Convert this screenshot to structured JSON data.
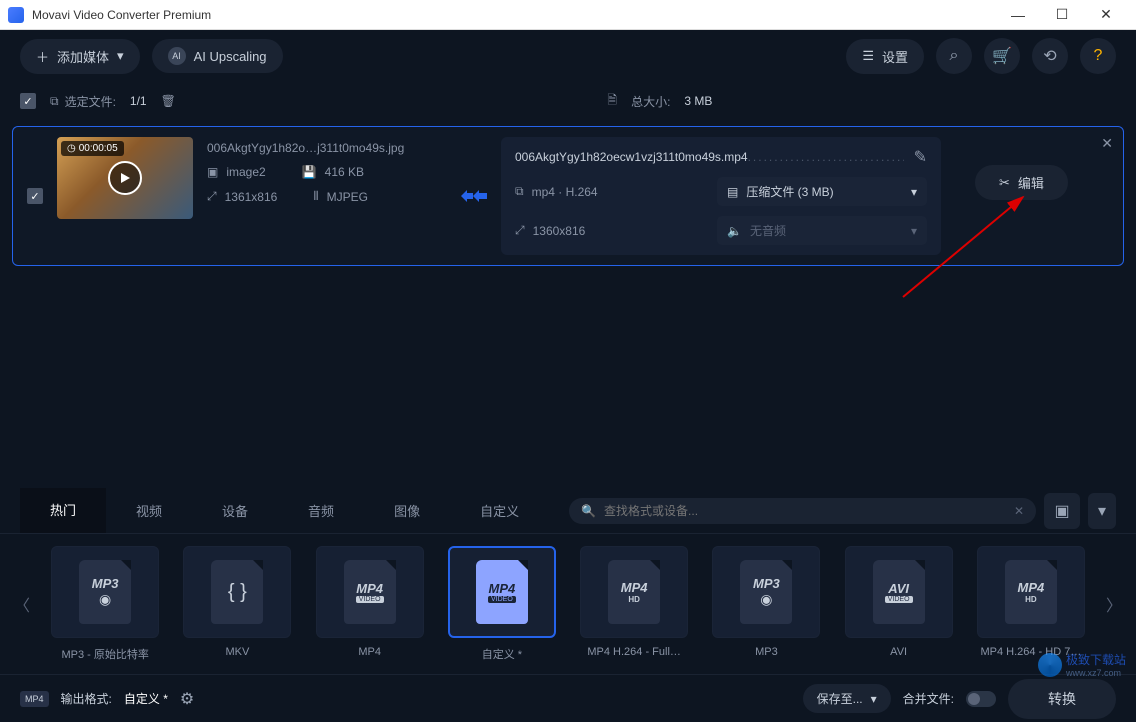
{
  "window": {
    "title": "Movavi Video Converter Premium"
  },
  "toolbar": {
    "add_media": "添加媒体",
    "ai_upscaling": "AI Upscaling",
    "settings": "设置"
  },
  "selection": {
    "label": "选定文件:",
    "count": "1/1",
    "total_label": "总大小:",
    "total_size": "3 MB"
  },
  "file": {
    "duration": "00:00:05",
    "src_name": "006AkgtYgy1h82o…j311t0mo49s.jpg",
    "image_label": "image2",
    "size": "416 KB",
    "dimensions": "1361x816",
    "codec": "MJPEG",
    "out_name": "006AkgtYgy1h82oecw1vzj311t0mo49s.mp4",
    "out_codec": "mp4 · H.264",
    "compress_label": "压缩文件 (3 MB)",
    "out_dimensions": "1360x816",
    "no_audio": "无音频",
    "edit_label": "编辑"
  },
  "tabs": [
    "热门",
    "视频",
    "设备",
    "音频",
    "图像",
    "自定义"
  ],
  "search": {
    "placeholder": "查找格式或设备..."
  },
  "formats": [
    {
      "label": "MP3 - 原始比特率",
      "main": "MP3",
      "kind": "mp3"
    },
    {
      "label": "MKV",
      "main": "MKV",
      "kind": "mkv"
    },
    {
      "label": "MP4",
      "main": "MP4",
      "sub": "VIDEO",
      "kind": "mp4"
    },
    {
      "label": "自定义 *",
      "main": "MP4",
      "sub": "VIDEO",
      "kind": "mp4",
      "selected": true
    },
    {
      "label": "MP4 H.264 - Full…",
      "main": "MP4",
      "hd": "HD",
      "kind": "mp4hd"
    },
    {
      "label": "MP3",
      "main": "MP3",
      "kind": "mp3"
    },
    {
      "label": "AVI",
      "main": "AVI",
      "sub": "VIDEO",
      "kind": "avi"
    },
    {
      "label": "MP4 H.264 - HD 7…",
      "main": "MP4",
      "hd": "HD",
      "kind": "mp4hd"
    }
  ],
  "footer": {
    "output_label": "输出格式:",
    "output_value": "自定义 *",
    "save_to": "保存至...",
    "merge": "合并文件:",
    "convert": "转换"
  },
  "watermark": {
    "text": "极致下载站",
    "url": "www.xz7.com"
  }
}
